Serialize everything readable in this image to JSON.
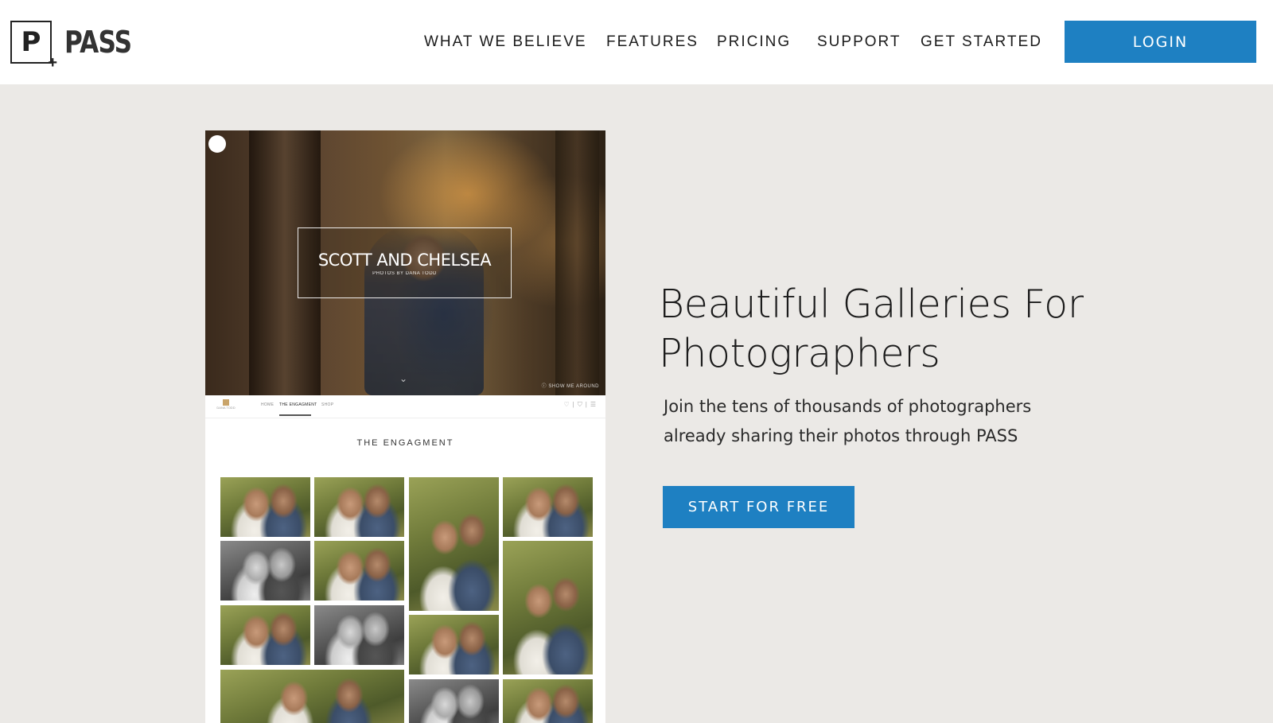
{
  "brand": {
    "logo_letter": "P",
    "logo_plus": "+",
    "name": "PASS"
  },
  "nav": {
    "items": [
      {
        "label": "WHAT WE BELIEVE"
      },
      {
        "label": "FEATURES"
      },
      {
        "label": "PRICING"
      },
      {
        "label": "SUPPORT"
      },
      {
        "label": "GET STARTED"
      }
    ],
    "login_label": "LOGIN"
  },
  "preview": {
    "hero_title": "SCOTT AND CHELSEA",
    "hero_subtitle": "PHOTOS BY DANA TODD",
    "hero_dot": "•",
    "hero_chevron": "⌄",
    "show_me_around": "ⓘ  SHOW ME AROUND",
    "subnav": {
      "logo_text": "DANA TODD",
      "items": [
        "HOME",
        "THE ENGAGMENT",
        "SHOP"
      ],
      "icons": "♡|⛉|☰"
    },
    "section_title": "THE ENGAGMENT"
  },
  "hero": {
    "headline_line1": "Beautiful Galleries For",
    "headline_line2": "Photographers",
    "subtext_line1": "Join the tens of thousands of photographers",
    "subtext_line2": "already sharing their photos through PASS",
    "cta_label": "START FOR FREE"
  },
  "colors": {
    "accent": "#1e80c2",
    "page_background": "#ebe9e6",
    "header_background": "#ffffff"
  }
}
